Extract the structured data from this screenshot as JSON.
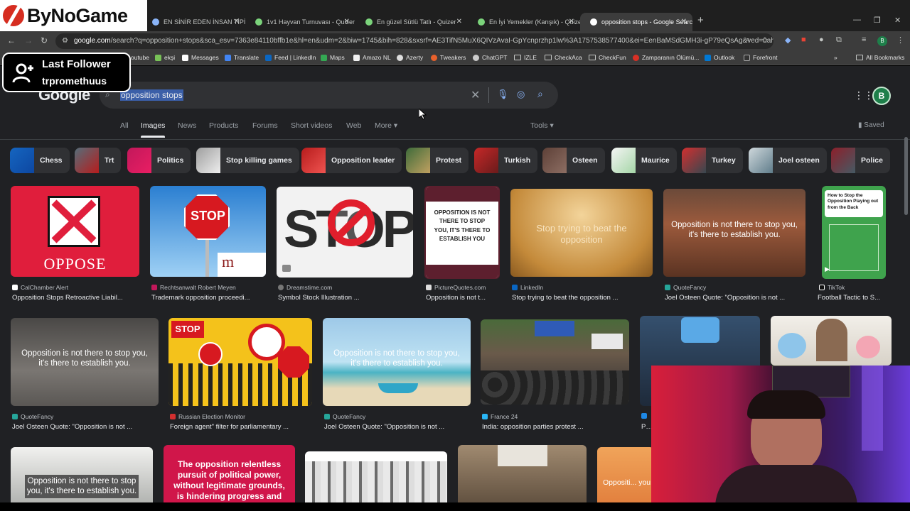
{
  "browser": {
    "tabs": [
      {
        "title": "EN SİNİR EDEN İNSAN TİPİ - Quizer"
      },
      {
        "title": "1v1 Hayvan Turnuvası - Quizer"
      },
      {
        "title": "En güzel Sütlü Tatlı - Quizer"
      },
      {
        "title": "En İyi Yemekler (Karışık) - Quizer"
      },
      {
        "title": "opposition stops - Google Search"
      }
    ],
    "url_host": "google.com",
    "url_path": "/search?q=opposition+stops&sca_esv=7363e84110bffb1e&hl=en&udm=2&biw=1745&bih=828&sxsrf=AE3TifN5MuX6QIVzAvaI-GpYcnprzhp1lw%3A1757538577400&ei=EenBaMSdGMH3i-gP79eQsAg&ved=0ahU...",
    "bookmarks": [
      "outube",
      "ekşi",
      "Messages",
      "Translate",
      "Feed | LinkedIn",
      "Maps",
      "Amazo NL",
      "Azerty",
      "Tweakers",
      "ChatGPT",
      "IZLE",
      "CheckAca",
      "CheckFun",
      "Zamparanın Ölümü...",
      "Outlook",
      "Forefront"
    ],
    "all_bookmarks": "All Bookmarks"
  },
  "google": {
    "logo": "Google",
    "query": "opposition stops",
    "avatar_letter": "B",
    "tabs": [
      "All",
      "Images",
      "News",
      "Products",
      "Forums",
      "Short videos",
      "Web",
      "More"
    ],
    "tools": "Tools",
    "saved": "Saved",
    "chips": [
      "Chess",
      "Trt",
      "Politics",
      "Stop killing games",
      "Opposition leader",
      "Protest",
      "Turkish",
      "Osteen",
      "Maurice",
      "Turkey",
      "Joel osteen",
      "Police"
    ],
    "row1": [
      {
        "source": "CalChamber Alert",
        "title": "Opposition Stops Retroactive Liabil...",
        "text": "OPPOSE"
      },
      {
        "source": "Rechtsanwalt Robert Meyen",
        "title": "Trademark opposition proceedi...",
        "text": "STOP"
      },
      {
        "source": "Dreamstime.com",
        "title": "Symbol Stock Illustration ...",
        "text": "STOP"
      },
      {
        "source": "PictureQuotes.com",
        "title": "Opposition is not t...",
        "text": "OPPOSITION IS NOT THERE TO STOP YOU, IT'S THERE TO ESTABLISH YOU"
      },
      {
        "source": "LinkedIn",
        "title": "Stop trying to beat the opposition ...",
        "text": "Stop trying to beat the opposition"
      },
      {
        "source": "QuoteFancy",
        "title": "Joel Osteen Quote: \"Opposition is not ...",
        "text": "Opposition is not there to stop you, it's there to establish you."
      },
      {
        "source": "TikTok",
        "title": "Football Tactic to S...",
        "text": "How to Stop the Opposition Playing out from the Back"
      }
    ],
    "row2": [
      {
        "source": "QuoteFancy",
        "title": "Joel Osteen Quote: \"Opposition is not ...",
        "text": "Opposition is not there to stop you, it's there to establish you."
      },
      {
        "source": "Russian Election Monitor",
        "title": "Foreign agent\" filter for parliamentary ...",
        "text": "STOP"
      },
      {
        "source": "QuoteFancy",
        "title": "Joel Osteen Quote: \"Opposition is not ...",
        "text": "Opposition is not there to stop you, it's there to establish you."
      },
      {
        "source": "France 24",
        "title": "India: opposition parties protest ...",
        "text": ""
      },
      {
        "source": "",
        "title": "PO...",
        "text": ""
      }
    ],
    "row3": [
      {
        "text": "Opposition is not there to stop you, it's there to establish you."
      },
      {
        "text": "The opposition relentless pursuit of political power, without legitimate grounds, is hindering progress and"
      },
      {
        "text": ""
      },
      {
        "text": ""
      },
      {
        "text": "Oppositi... you, it's th..."
      }
    ]
  },
  "overlay": {
    "logo_text": "ByNoGame",
    "follower_label": "Last Follower",
    "follower_name": "trpromethuus"
  }
}
